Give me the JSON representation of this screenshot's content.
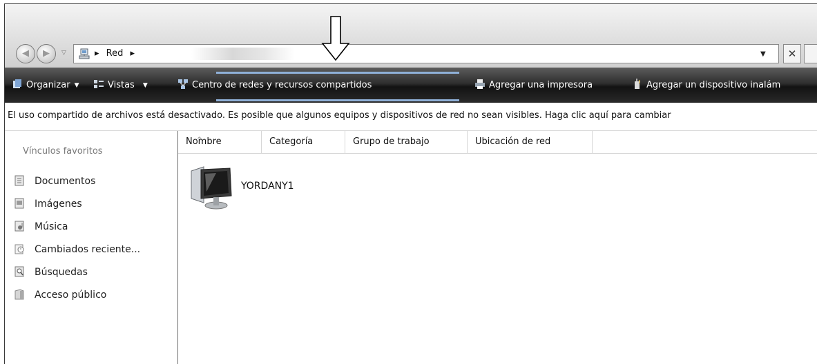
{
  "address": {
    "path_root": "Red",
    "separator": "▸"
  },
  "toolbar": {
    "organize": "Organizar",
    "views": "Vistas",
    "network_center": "Centro de redes y recursos compartidos",
    "add_printer": "Agregar una impresora",
    "add_wireless": "Agregar un dispositivo inalám"
  },
  "infobar": {
    "text": "El uso compartido de archivos está desactivado. Es posible que algunos equipos y dispositivos de red no sean visibles. Haga clic aquí para cambiar"
  },
  "sidebar": {
    "title": "Vínculos favoritos",
    "items": [
      {
        "label": "Documentos",
        "icon": "documents-icon"
      },
      {
        "label": "Imágenes",
        "icon": "pictures-icon"
      },
      {
        "label": "Música",
        "icon": "music-icon"
      },
      {
        "label": "Cambiados reciente...",
        "icon": "recent-icon"
      },
      {
        "label": "Búsquedas",
        "icon": "searches-icon"
      },
      {
        "label": "Acceso público",
        "icon": "public-icon"
      }
    ]
  },
  "columns": [
    "Nombre",
    "Categoría",
    "Grupo de trabajo",
    "Ubicación de red"
  ],
  "items": [
    {
      "name": "YORDANY1",
      "icon": "computer-icon"
    }
  ],
  "colors": {
    "toolbar_dark": "#121212",
    "highlight": "#8fb0d8"
  }
}
